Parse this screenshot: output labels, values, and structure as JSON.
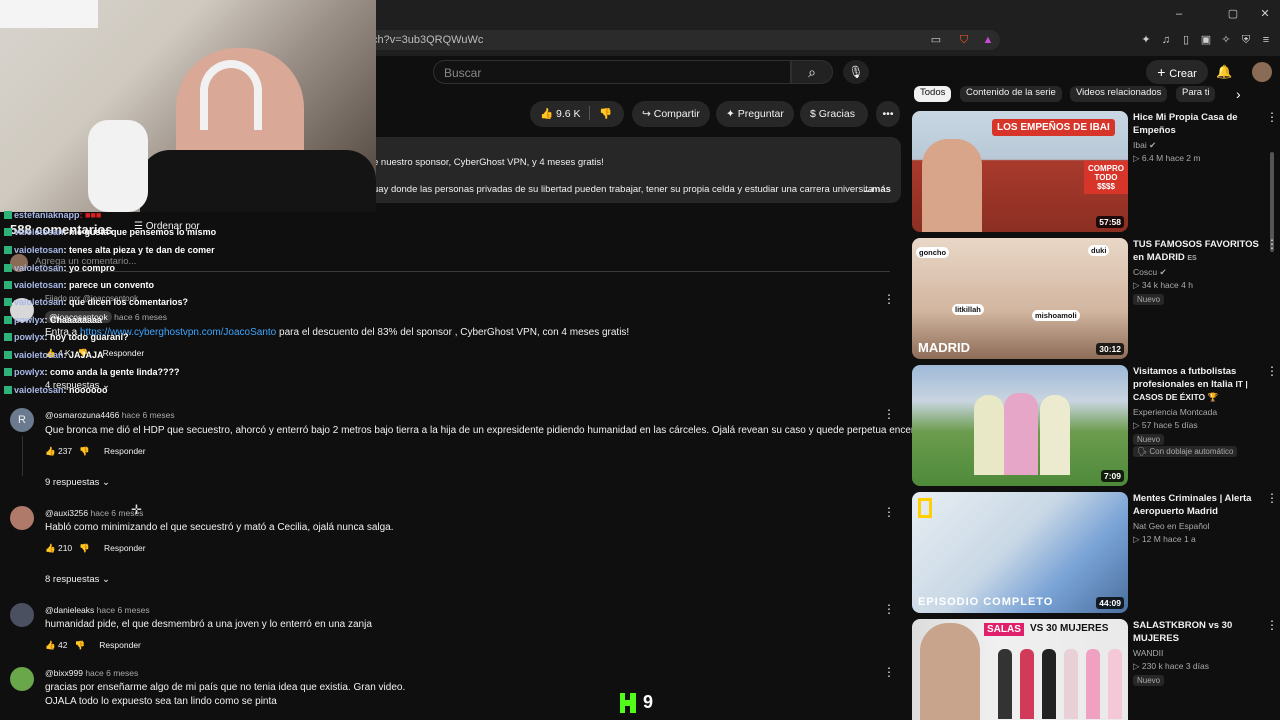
{
  "browser": {
    "url": "ch?v=3ub3QRQWuWc",
    "window_min": "–",
    "window_max": "▢",
    "window_close": "✕"
  },
  "header": {
    "search_placeholder": "Buscar",
    "create_label": "Crear"
  },
  "actions": {
    "likes": "9.6 K",
    "share": "Compartir",
    "ask": "Preguntar",
    "thanks": "Gracias"
  },
  "description": {
    "line1": "e nuestro sponsor, CyberGhost VPN, y 4 meses gratis!",
    "line2": "uay donde las personas privadas de su libertad pueden trabajar, tener su propia celda y estudiar una carrera universita",
    "more": "...más"
  },
  "comments_section": {
    "count": "588 comentarios",
    "sort": "Ordenar por",
    "add_placeholder": "Agrega un comentario...",
    "pinned_by": "Fijado por @joacosantook"
  },
  "pinned_comment": {
    "handle": "@joacosantook",
    "time": "hace 6 meses",
    "text_prefix": "Entra a ",
    "link": "https://www.cyberghostvpn.com/JoacoSanto",
    "text_suffix": " para el descuento del 83% del sponsor , CyberGhost VPN, con 4 meses gratis!",
    "likes": "4 K",
    "reply": "Responder",
    "replies": "4 respuestas"
  },
  "comments": [
    {
      "handle": "@osmarozuna4466",
      "time": "hace 6 meses",
      "text": "Que bronca me dió el HDP que secuestro, ahorcó y enterró bajo 2 metros bajo tierra a la hija de un expresidente pidiendo humanidad en las cárceles. Ojalá revean su caso y quede perpetua encerrado",
      "likes": "237",
      "reply": "Responder",
      "replies": "9 respuestas",
      "avatar_letter": "R",
      "avatar_color": "#6b7a8f"
    },
    {
      "handle": "@auxi3256",
      "time": "hace 6 meses",
      "text": "Habló como minimizando el que secuestró y mató a Cecilia, ojalá nunca salga.",
      "likes": "210",
      "reply": "Responder",
      "replies": "8 respuestas",
      "avatar_letter": "",
      "avatar_color": "#b07a6a"
    },
    {
      "handle": "@danieleaks",
      "time": "hace 6 meses",
      "text": "humanidad pide, el que desmembró a una joven y lo enterró en una zanja",
      "likes": "42",
      "reply": "Responder",
      "avatar_letter": "",
      "avatar_color": "#4a5060"
    },
    {
      "handle": "@bixx999",
      "time": "hace 6 meses",
      "text": "gracias por enseñarme algo de mi país que no tenia idea que existia. Gran video.",
      "text2": "OJALA todo lo expuesto sea tan lindo como se pinta",
      "avatar_letter": "",
      "avatar_color": "#6aa64a"
    }
  ],
  "chat": [
    {
      "user": "estefaniaknapp",
      "msg": ": ■■■"
    },
    {
      "user": "vaioletosan",
      "msg": ": me gusta que pensemos lo mismo"
    },
    {
      "user": "vaioletosan",
      "msg": ": tenes alta pieza y te dan de comer"
    },
    {
      "user": "vaioletosan",
      "msg": ": yo compro"
    },
    {
      "user": "vaioletosan",
      "msg": ": parece un convento"
    },
    {
      "user": "vaioletosan",
      "msg": ": que dicen los comentarios?"
    },
    {
      "user": "powlyx",
      "msg": ": Chaaaaaaaa"
    },
    {
      "user": "powlyx",
      "msg": ": hoy todo guarani?"
    },
    {
      "user": "vaioletosan",
      "msg": ": JAJAJA"
    },
    {
      "user": "powlyx",
      "msg": ": como anda la gente linda????"
    },
    {
      "user": "vaioletosan",
      "msg": ": noooooo"
    }
  ],
  "kick_overlay": {
    "count": "9",
    "color": "#53fc18"
  },
  "sidebar": {
    "chips": [
      "Todos",
      "Contenido de la serie",
      "Videos relacionados",
      "Para ti"
    ],
    "videos": [
      {
        "title": "Hice Mi Propia Casa de Empeños",
        "channel": "Ibai",
        "verified": true,
        "stats": "▷ 6.4 M   hace 2 m",
        "duration": "57:58",
        "thumb_text": "LOS EMPEÑOS DE IBAI",
        "thumb_text2": "COMPRO TODO $$$$"
      },
      {
        "title": "TUS FAMOSOS FAVORITOS en MADRID",
        "title_suffix": "ES",
        "channel": "Coscu",
        "verified": true,
        "stats": "▷ 34 k   hace 4 h",
        "badge": "Nuevo",
        "duration": "30:12",
        "thumb_text": "MADRID",
        "thumb_labels": [
          "goncho",
          "duki",
          "litkillah",
          "mishoamoli"
        ]
      },
      {
        "title": "Visitamos a futbolistas profesionales en Italia",
        "title_suffix": "IT | CASOS DE ÉXITO 🏆",
        "channel": "Experiencia Montcada",
        "stats": "▷ 57   hace 5 días",
        "badge": "Nuevo",
        "badge2": "Con doblaje automático",
        "duration": "7:09"
      },
      {
        "title": "Mentes Criminales | Alerta Aeropuerto Madrid",
        "channel": "Nat Geo en Español",
        "stats": "▷ 12 M   hace 1 a",
        "duration": "44:09",
        "thumb_text": "EPISODIO COMPLETO"
      },
      {
        "title": "SALASTKBRON vs 30 MUJERES",
        "channel": "WANDII",
        "stats": "▷ 230 k   hace 3 días",
        "badge": "Nuevo",
        "thumb_text": "SALAS",
        "thumb_text2": "VS 30 MUJERES"
      }
    ]
  }
}
